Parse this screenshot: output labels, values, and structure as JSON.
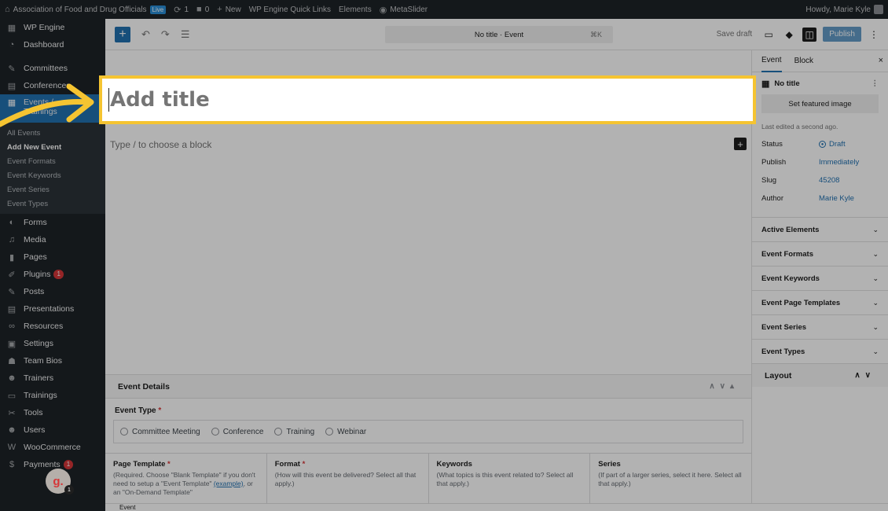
{
  "adminbar": {
    "site_name": "Association of Food and Drug Officials",
    "live": "Live",
    "updates": "1",
    "comments": "0",
    "new": "New",
    "quick_links": "WP Engine Quick Links",
    "elements": "Elements",
    "metaslider": "MetaSlider",
    "howdy": "Howdy, Marie Kyle"
  },
  "sidebar": {
    "items": [
      {
        "label": "WP Engine",
        "icon": "wpengine-icon"
      },
      {
        "label": "Dashboard",
        "icon": "dashboard-icon"
      },
      {
        "label": "Committees",
        "icon": "pin-icon"
      },
      {
        "label": "Conferences",
        "icon": "grid-icon"
      },
      {
        "label": "Events / Trainings",
        "icon": "calendar-icon"
      },
      {
        "label": "Forms",
        "icon": "forms-icon"
      },
      {
        "label": "Media",
        "icon": "media-icon"
      },
      {
        "label": "Pages",
        "icon": "pages-icon"
      },
      {
        "label": "Plugins",
        "icon": "plugin-icon",
        "badge": "1"
      },
      {
        "label": "Posts",
        "icon": "pin-icon"
      },
      {
        "label": "Presentations",
        "icon": "document-icon"
      },
      {
        "label": "Resources",
        "icon": "link-icon"
      },
      {
        "label": "Settings",
        "icon": "settings-icon"
      },
      {
        "label": "Team Bios",
        "icon": "team-icon"
      },
      {
        "label": "Trainers",
        "icon": "user-icon"
      },
      {
        "label": "Trainings",
        "icon": "monitor-icon"
      },
      {
        "label": "Tools",
        "icon": "wrench-icon"
      },
      {
        "label": "Users",
        "icon": "user-icon"
      },
      {
        "label": "WooCommerce",
        "icon": "woo-icon"
      },
      {
        "label": "Payments",
        "icon": "dollar-icon",
        "badge": "1"
      }
    ],
    "events_line1": "Events /",
    "events_line2": "Trainings",
    "submenu": [
      "All Events",
      "Add New Event",
      "Event Formats",
      "Event Keywords",
      "Event Series",
      "Event Types"
    ]
  },
  "header": {
    "doc_title": "No title · Event",
    "shortcut": "⌘K",
    "save_draft": "Save draft",
    "publish": "Publish"
  },
  "canvas": {
    "title_placeholder": "Add title",
    "block_placeholder": "Type / to choose a block"
  },
  "metabox": {
    "title": "Event Details",
    "event_type_label": "Event Type",
    "event_types": [
      "Committee Meeting",
      "Conference",
      "Training",
      "Webinar"
    ],
    "columns": [
      {
        "title": "Page Template",
        "required": true,
        "desc": "(Required. Choose \"Blank Template\" if you don't need to setup a \"Event Template\"",
        "link": "(example)",
        "desc2": ", or an \"On-Demand Template\""
      },
      {
        "title": "Format",
        "required": true,
        "desc": "(How will this event be delivered? Select all that apply.)"
      },
      {
        "title": "Keywords",
        "required": false,
        "desc": "(What topics is this event related to? Select all that apply.)"
      },
      {
        "title": "Series",
        "required": false,
        "desc": "(If part of a larger series, select it here. Select all that apply.)"
      }
    ]
  },
  "footer": {
    "breadcrumb": "Event"
  },
  "settings": {
    "tabs": [
      "Event",
      "Block"
    ],
    "doc_name": "No title",
    "featured_image": "Set featured image",
    "last_edited": "Last edited a second ago.",
    "rows": [
      {
        "k": "Status",
        "v": "Draft"
      },
      {
        "k": "Publish",
        "v": "Immediately"
      },
      {
        "k": "Slug",
        "v": "45208"
      },
      {
        "k": "Author",
        "v": "Marie Kyle"
      }
    ],
    "panels": [
      "Active Elements",
      "Event Formats",
      "Event Keywords",
      "Event Page Templates",
      "Event Series",
      "Event Types"
    ],
    "layout": "Layout"
  },
  "guide": {
    "letter": "g.",
    "count": "1"
  },
  "colors": {
    "highlight": "#f5c431",
    "accent": "#2271b1",
    "admin_dark": "#1d2327"
  }
}
